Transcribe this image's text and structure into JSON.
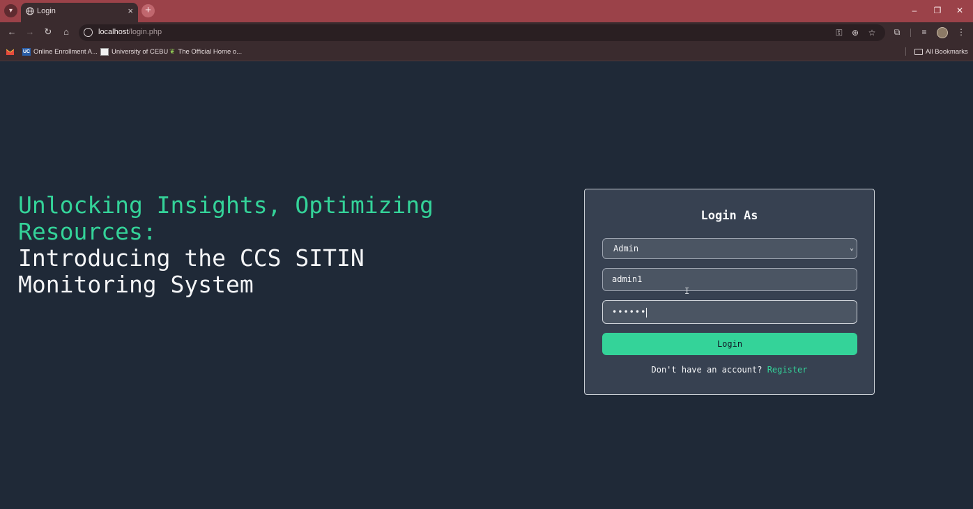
{
  "browser": {
    "tab_title": "Login",
    "url_host": "localhost",
    "url_path": "/login.php",
    "bookmarks": [
      {
        "label": "Online Enrollment A...",
        "icon": "uc-icon"
      },
      {
        "label": "University of CEBU",
        "icon": "uc-crest-icon"
      },
      {
        "label": "The Official Home o...",
        "icon": "leaf-icon"
      }
    ],
    "all_bookmarks_label": "All Bookmarks",
    "theme_color": "#9b4249"
  },
  "hero": {
    "accent_line": "Unlocking Insights, Optimizing Resources:",
    "main_line": "Introducing the CCS SITIN Monitoring System",
    "accent_color": "#34d399"
  },
  "login": {
    "title": "Login As",
    "role_selected": "Admin",
    "username_value": "admin1",
    "password_value": "••••••",
    "button_label": "Login",
    "no_account_text": "Don't have an account?",
    "register_label": "Register"
  }
}
